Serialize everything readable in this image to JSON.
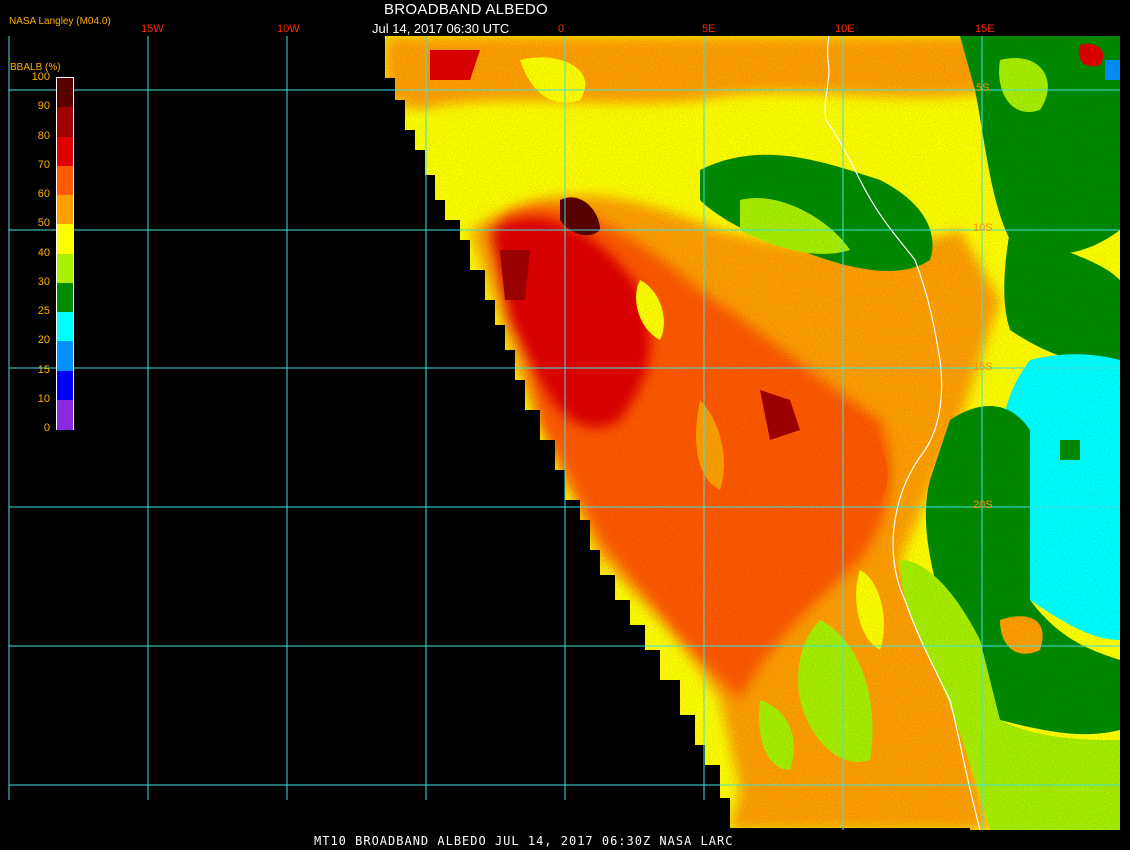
{
  "header": {
    "title": "BROADBAND ALBEDO",
    "datetime": "Jul 14, 2017 06:30 UTC",
    "agency": "NASA Langley (M04.0)"
  },
  "colorbar": {
    "title": "BBALB (%)",
    "ticks": [
      "100",
      "90",
      "80",
      "70",
      "60",
      "50",
      "40",
      "30",
      "25",
      "20",
      "15",
      "10",
      "0"
    ],
    "colors": [
      "#5a0000",
      "#a00000",
      "#e00000",
      "#ff5a00",
      "#ffa000",
      "#ffff00",
      "#a8f000",
      "#008c00",
      "#00ffff",
      "#0090ff",
      "#0000ff",
      "#8a2be2"
    ]
  },
  "grid": {
    "lon_labels": [
      "15W",
      "10W",
      "0",
      "5E",
      "10E",
      "15E"
    ],
    "lat_labels": [
      "5S",
      "10S",
      "15S",
      "20S"
    ]
  },
  "footer": {
    "text": "MT10  BROADBAND ALBEDO   JUL 14, 2017 06:30Z   NASA LARC"
  },
  "colors": {
    "grid_line": "#40e0e0",
    "coastline": "#ffffff",
    "background": "#000000"
  }
}
